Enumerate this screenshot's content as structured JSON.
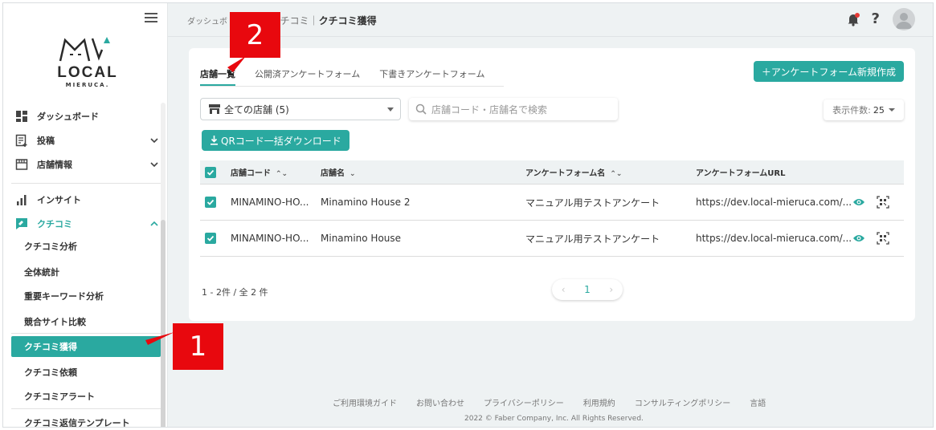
{
  "sidebar": {
    "logo_text": "LOCAL",
    "logo_sub": "MIERUCA.",
    "items": [
      {
        "label": "ダッシュボード"
      },
      {
        "label": "投稿"
      },
      {
        "label": "店舗情報"
      },
      {
        "label": "インサイト"
      },
      {
        "label": "クチコミ"
      }
    ],
    "sub_items": [
      {
        "label": "クチコミ分析"
      },
      {
        "label": "全体統計"
      },
      {
        "label": "重要キーワード分析"
      },
      {
        "label": "競合サイト比較"
      },
      {
        "label": "クチコミ獲得"
      },
      {
        "label": "クチコミ依頼"
      },
      {
        "label": "クチコミアラート"
      },
      {
        "label": "クチコミ返信テンプレート"
      }
    ]
  },
  "header": {
    "breadcrumb_prefix": "ダッシュボ",
    "breadcrumb_mid": "チコミ｜",
    "breadcrumb_current": "クチコミ獲得",
    "help": "?"
  },
  "tabs": [
    {
      "label": "店舗一覧"
    },
    {
      "label": "公開済アンケートフォーム"
    },
    {
      "label": "下書きアンケートフォーム"
    }
  ],
  "buttons": {
    "new_form": "＋アンケートフォーム新規作成",
    "qr_download": "QRコード一括ダウンロード"
  },
  "filters": {
    "store_select": "全ての店舗 (5)",
    "search_placeholder": "店舗コード・店舗名で検索",
    "per_page_label": "表示件数:",
    "per_page_value": "25"
  },
  "table": {
    "headers": [
      "店舗コード",
      "店舗名",
      "アンケートフォーム名",
      "アンケートフォームURL"
    ],
    "rows": [
      {
        "code": "MINAMINO-HO...",
        "name": "Minamino House 2",
        "form": "マニュアル用テストアンケート",
        "url": "https://dev.local-mieruca.com/..."
      },
      {
        "code": "MINAMINO-HO...",
        "name": "Minamino House",
        "form": "マニュアル用テストアンケート",
        "url": "https://dev.local-mieruca.com/..."
      }
    ]
  },
  "pagination": {
    "count": "1 - 2件 / 全 2 件",
    "current_page": "1",
    "prev": "‹",
    "next": "›"
  },
  "footer": {
    "links": [
      "ご利用環境ガイド",
      "お問い合わせ",
      "プライバシーポリシー",
      "利用規約",
      "コンサルティングポリシー",
      "言語"
    ],
    "copyright": "2022 © Faber Company, Inc. All Rights Reserved."
  },
  "annotations": {
    "one": "1",
    "two": "2",
    "color": "#e8080e"
  },
  "colors": {
    "accent": "#2aa9a0"
  }
}
